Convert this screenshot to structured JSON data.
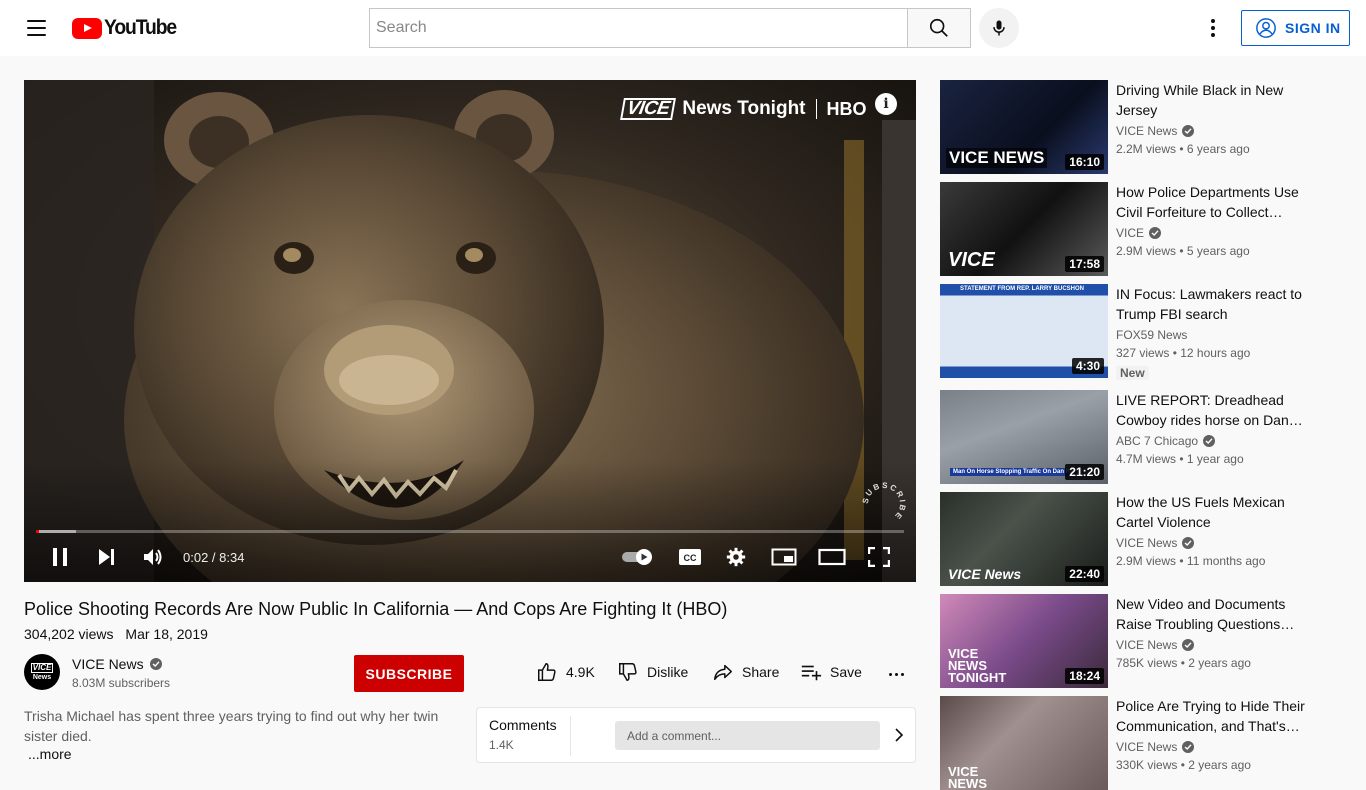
{
  "header": {
    "logo_text": "YouTube",
    "search_placeholder": "Search",
    "sign_in_label": "SIGN IN"
  },
  "player": {
    "overlay_brand_vice": "VICE",
    "overlay_brand_show": "News Tonight",
    "overlay_brand_hbo": "HBO",
    "info_glyph": "i",
    "watermark_text": "SUBSCRIBE",
    "time_display": "0:02 / 8:34",
    "played_fraction": 0.004,
    "buffered_fraction": 0.046,
    "icons": [
      "pause-icon",
      "next-icon",
      "volume-icon",
      "autoplay-toggle-icon",
      "captions-icon",
      "settings-icon",
      "miniplayer-icon",
      "theater-icon",
      "fullscreen-icon"
    ]
  },
  "video": {
    "title": "Police Shooting Records Are Now Public In California — And Cops Are Fighting It (HBO)",
    "views": "304,202 views",
    "date": "Mar 18, 2019",
    "like_count": "4.9K",
    "dislike_label": "Dislike",
    "share_label": "Share",
    "save_label": "Save"
  },
  "channel": {
    "avatar_top": "VICE",
    "avatar_bottom": "News",
    "name": "VICE News",
    "subscribers": "8.03M subscribers",
    "subscribe_label": "SUBSCRIBE"
  },
  "description": {
    "text": "Trisha Michael has spent three years trying to find out why her twin sister died.",
    "more_label": "...more"
  },
  "comments": {
    "title": "Comments",
    "count": "1.4K",
    "placeholder": "Add a comment..."
  },
  "recommendations": [
    {
      "title": "Driving While Black in New Jersey",
      "channel": "VICE News",
      "verified": true,
      "views": "2.2M views",
      "age": "6 years ago",
      "duration": "16:10",
      "thumb_text": "VICE NEWS",
      "badge": ""
    },
    {
      "title": "How Police Departments Use Civil Forfeiture to Collect…",
      "channel": "VICE",
      "verified": true,
      "views": "2.9M views",
      "age": "5 years ago",
      "duration": "17:58",
      "thumb_text": "VICE",
      "badge": ""
    },
    {
      "title": "IN Focus: Lawmakers react to Trump FBI search",
      "channel": "FOX59 News",
      "verified": false,
      "views": "327 views",
      "age": "12 hours ago",
      "duration": "4:30",
      "thumb_text": "STATEMENT FROM REP. LARRY BUCSHON",
      "badge": "New"
    },
    {
      "title": "LIVE REPORT: Dreadhead Cowboy rides horse on Dan…",
      "channel": "ABC 7 Chicago",
      "verified": true,
      "views": "4.7M views",
      "age": "1 year ago",
      "duration": "21:20",
      "thumb_text": "Man On Horse Stopping Traffic On Dan Ry",
      "badge": ""
    },
    {
      "title": "How the US Fuels Mexican Cartel Violence",
      "channel": "VICE News",
      "verified": true,
      "views": "2.9M views",
      "age": "11 months ago",
      "duration": "22:40",
      "thumb_text": "VICE News",
      "badge": ""
    },
    {
      "title": "New Video and Documents Raise Troubling Questions…",
      "channel": "VICE News",
      "verified": true,
      "views": "785K views",
      "age": "2 years ago",
      "duration": "18:24",
      "thumb_text": "VICE NEWS TONIGHT",
      "badge": ""
    },
    {
      "title": "Police Are Trying to Hide Their Communication, and That's…",
      "channel": "VICE News",
      "verified": true,
      "views": "330K views",
      "age": "2 years ago",
      "duration": "",
      "thumb_text": "VICE NEWS",
      "badge": ""
    }
  ],
  "colors": {
    "brand_red": "#ff0000",
    "subscribe_red": "#cc0000",
    "link_blue": "#065fd4",
    "secondary_text": "#606060"
  }
}
